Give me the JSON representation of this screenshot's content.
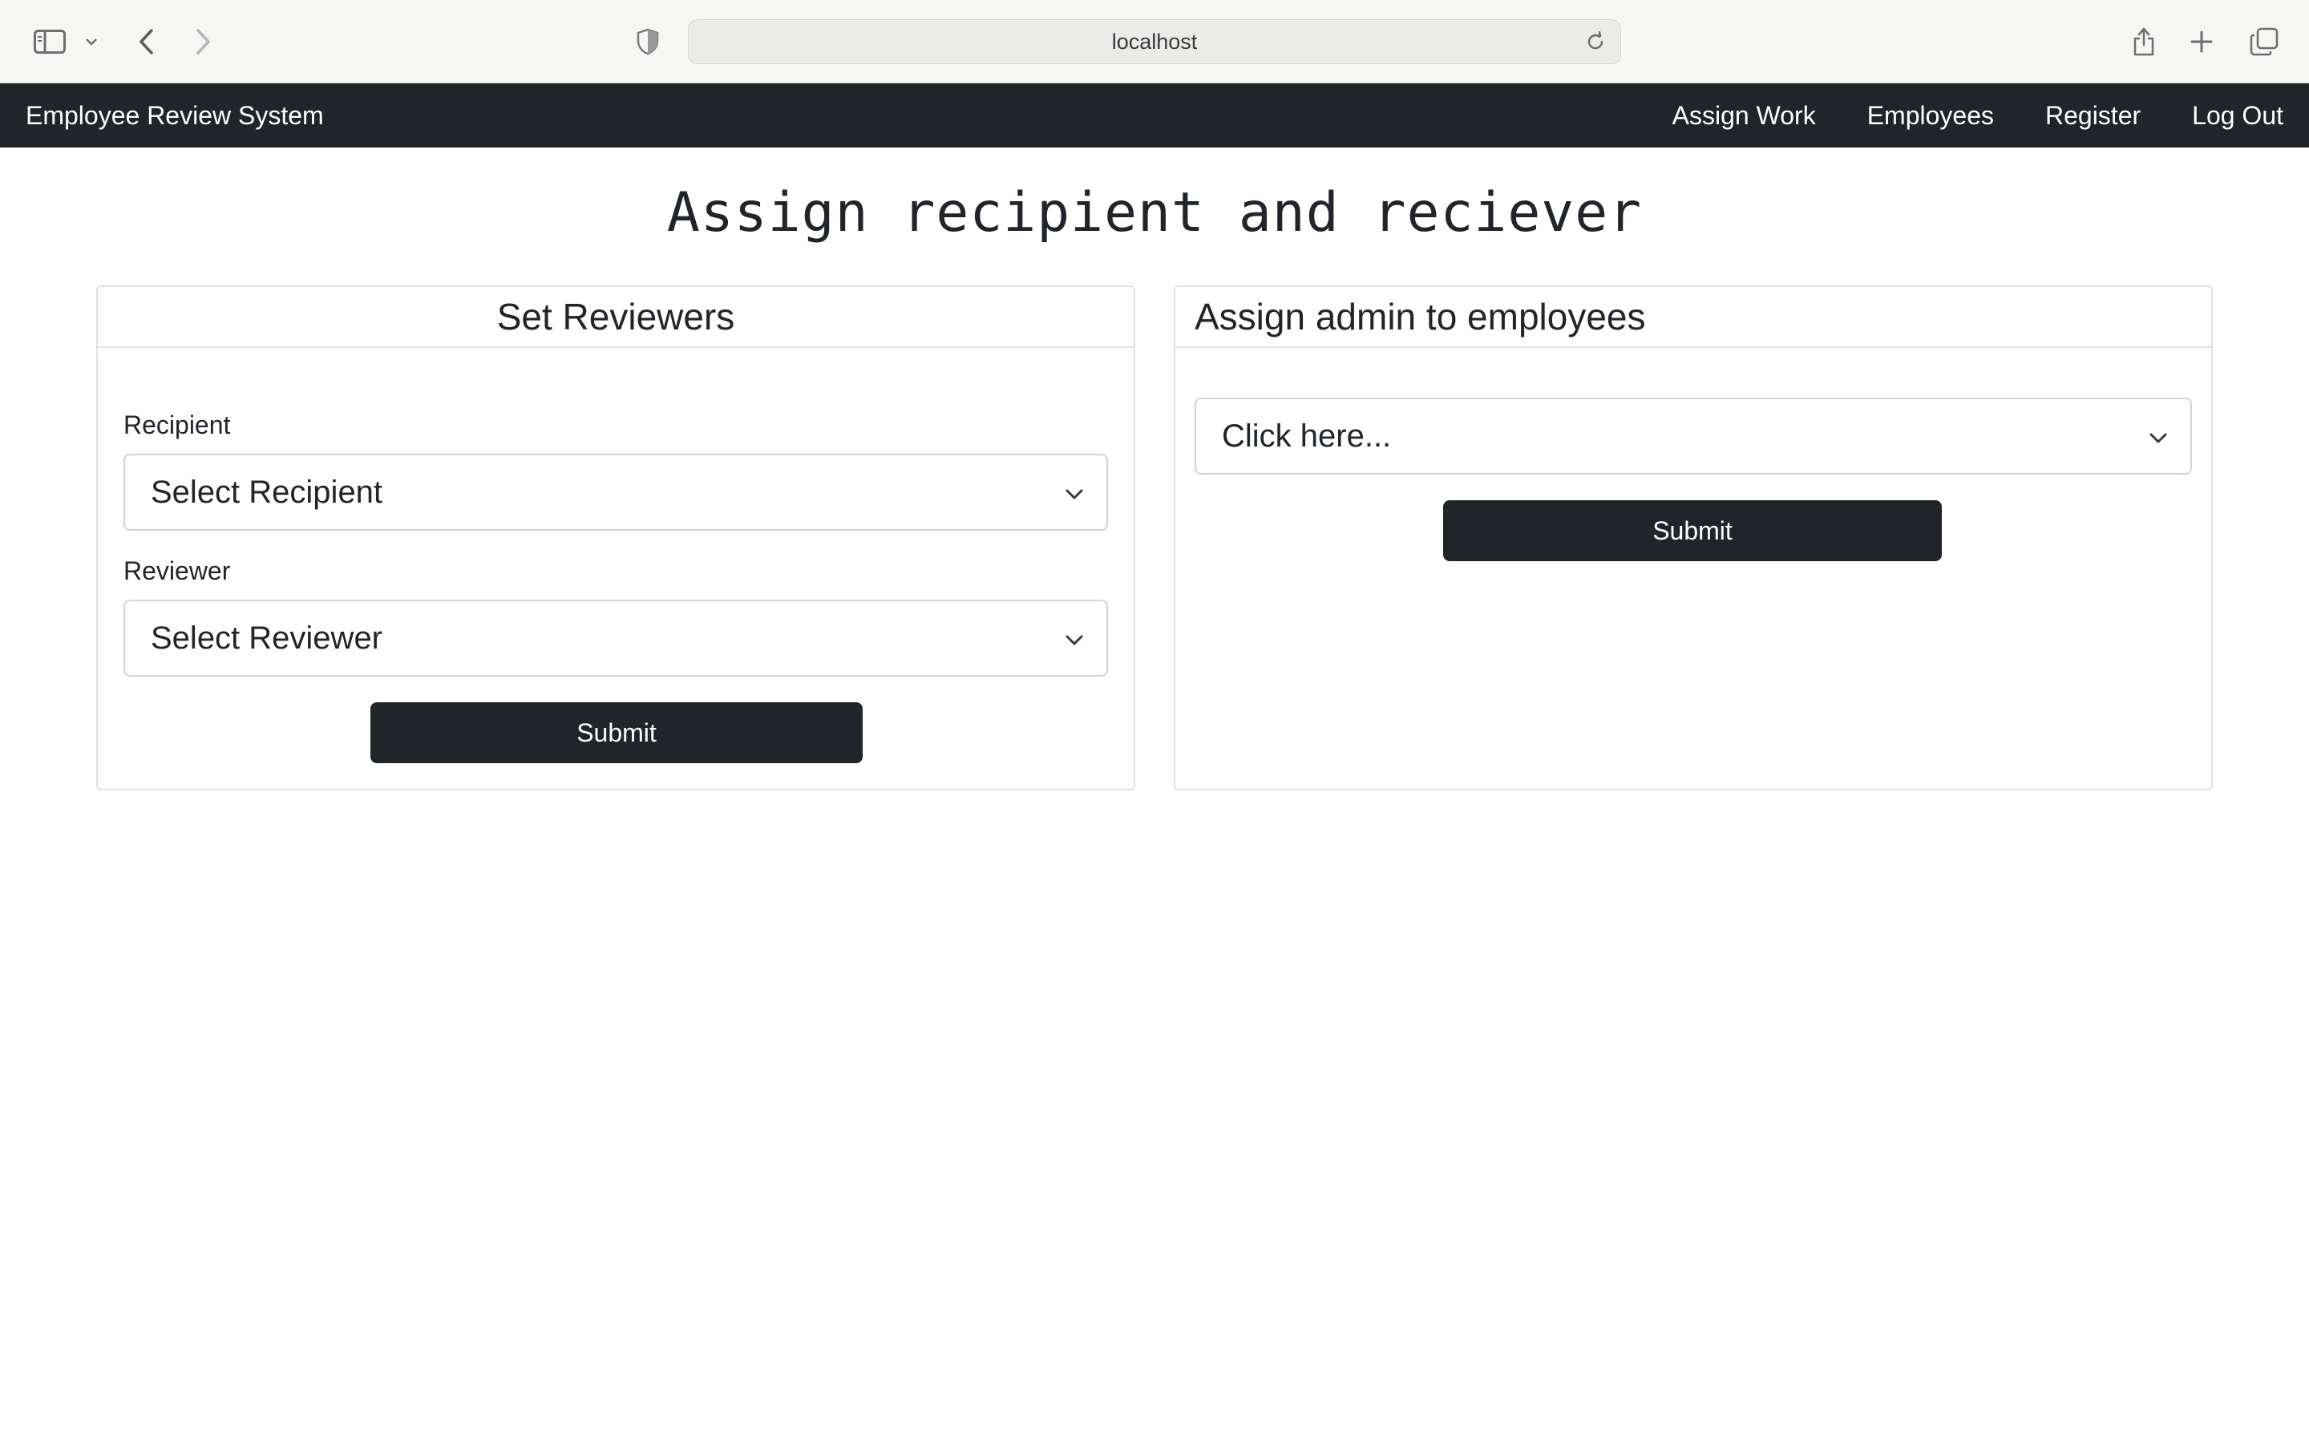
{
  "browser": {
    "url": "localhost"
  },
  "navbar": {
    "brand": "Employee Review System",
    "links": [
      "Assign Work",
      "Employees",
      "Register",
      "Log Out"
    ]
  },
  "page": {
    "title": "Assign recipient and reciever"
  },
  "set_reviewers": {
    "header": "Set Reviewers",
    "recipient_label": "Recipient",
    "recipient_select": "Select Recipient",
    "reviewer_label": "Reviewer",
    "reviewer_select": "Select Reviewer",
    "submit": "Submit"
  },
  "assign_admin": {
    "header": "Assign admin to employees",
    "select": "Click here...",
    "submit": "Submit"
  },
  "colors": {
    "navbar_bg": "#212529",
    "button_bg": "#212529",
    "border": "#dee2e6"
  }
}
